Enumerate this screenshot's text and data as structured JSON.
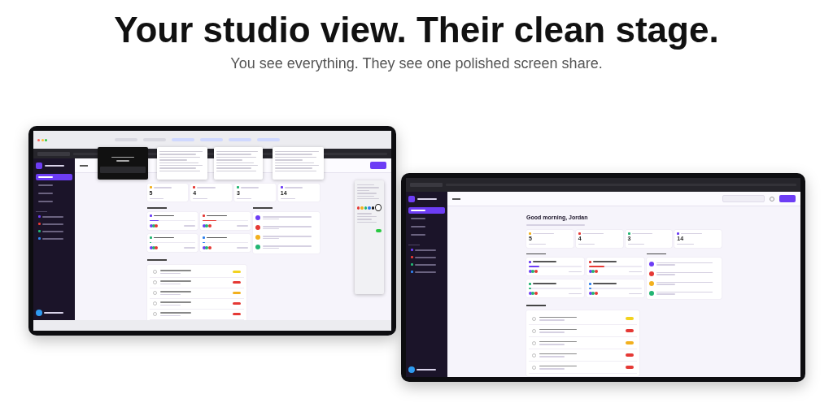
{
  "hero": {
    "title": "Your studio view. Their clean stage.",
    "subtitle": "You see everything. They see one polished screen share."
  },
  "devices": [
    {
      "kind": "presenter",
      "app": {
        "nav": [
          {
            "selected": true
          },
          {
            "selected": false
          },
          {
            "selected": false
          },
          {
            "selected": false
          }
        ],
        "sidebar_projects": [
          {
            "color": "#6d3df5"
          },
          {
            "color": "#e53935"
          },
          {
            "color": "#22b573"
          },
          {
            "color": "#2f80ed"
          }
        ],
        "stats": [
          {
            "value": "5",
            "color": "#f2b01e"
          },
          {
            "value": "4",
            "color": "#e53935"
          },
          {
            "value": "3",
            "color": "#22b573"
          },
          {
            "value": "14",
            "color": "#6d3df5"
          }
        ],
        "projects": [
          {
            "color": "#6d3df5",
            "level": 0.2
          },
          {
            "color": "#e53935",
            "level": 0.3
          },
          {
            "color": "#22b573",
            "level": 0.05
          },
          {
            "color": "#2f80ed",
            "level": 0.05
          }
        ],
        "activity": [
          {
            "color": "#6d3df5"
          },
          {
            "color": "#e53935"
          },
          {
            "color": "#f2b01e"
          },
          {
            "color": "#22b573"
          }
        ],
        "tasks": [
          {
            "done": false,
            "color": "#f2d21e"
          },
          {
            "done": false,
            "color": "#e53935"
          },
          {
            "done": false,
            "color": "#f2b01e"
          },
          {
            "done": false,
            "color": "#e53935"
          },
          {
            "done": false,
            "color": "#e53935"
          }
        ]
      },
      "overlays": [
        {
          "kind": "prompt"
        },
        {
          "kind": "notes"
        },
        {
          "kind": "notes"
        },
        {
          "kind": "notes"
        },
        {
          "kind": "toolbox",
          "swatches": [
            {
              "color": "#e53935",
              "selected": false
            },
            {
              "color": "#f2b01e",
              "selected": false
            },
            {
              "color": "#22b573",
              "selected": false
            },
            {
              "color": "#2f80ed",
              "selected": false
            },
            {
              "color": "#111111",
              "selected": false
            },
            {
              "color": "#ffffff",
              "selected": true
            }
          ],
          "toggle_on": true
        }
      ]
    },
    {
      "kind": "audience",
      "app": {
        "nav": [
          {
            "selected": true
          },
          {
            "selected": false
          },
          {
            "selected": false
          },
          {
            "selected": false
          }
        ],
        "sidebar_projects": [
          {
            "color": "#6d3df5"
          },
          {
            "color": "#e53935"
          },
          {
            "color": "#22b573"
          },
          {
            "color": "#2f80ed"
          }
        ],
        "greeting": "Good morning, Jordan",
        "stats": [
          {
            "value": "5",
            "color": "#f2b01e"
          },
          {
            "value": "4",
            "color": "#e53935"
          },
          {
            "value": "3",
            "color": "#22b573"
          },
          {
            "value": "14",
            "color": "#6d3df5"
          }
        ],
        "projects": [
          {
            "color": "#6d3df5",
            "level": 0.2
          },
          {
            "color": "#e53935",
            "level": 0.3
          },
          {
            "color": "#22b573",
            "level": 0.05
          },
          {
            "color": "#2f80ed",
            "level": 0.05
          }
        ],
        "activity": [
          {
            "color": "#6d3df5"
          },
          {
            "color": "#e53935"
          },
          {
            "color": "#f2b01e"
          },
          {
            "color": "#22b573"
          }
        ],
        "tasks": [
          {
            "done": false,
            "color": "#f2d21e"
          },
          {
            "done": false,
            "color": "#e53935"
          },
          {
            "done": false,
            "color": "#f2b01e"
          },
          {
            "done": false,
            "color": "#e53935"
          },
          {
            "done": false,
            "color": "#e53935"
          }
        ]
      }
    }
  ]
}
